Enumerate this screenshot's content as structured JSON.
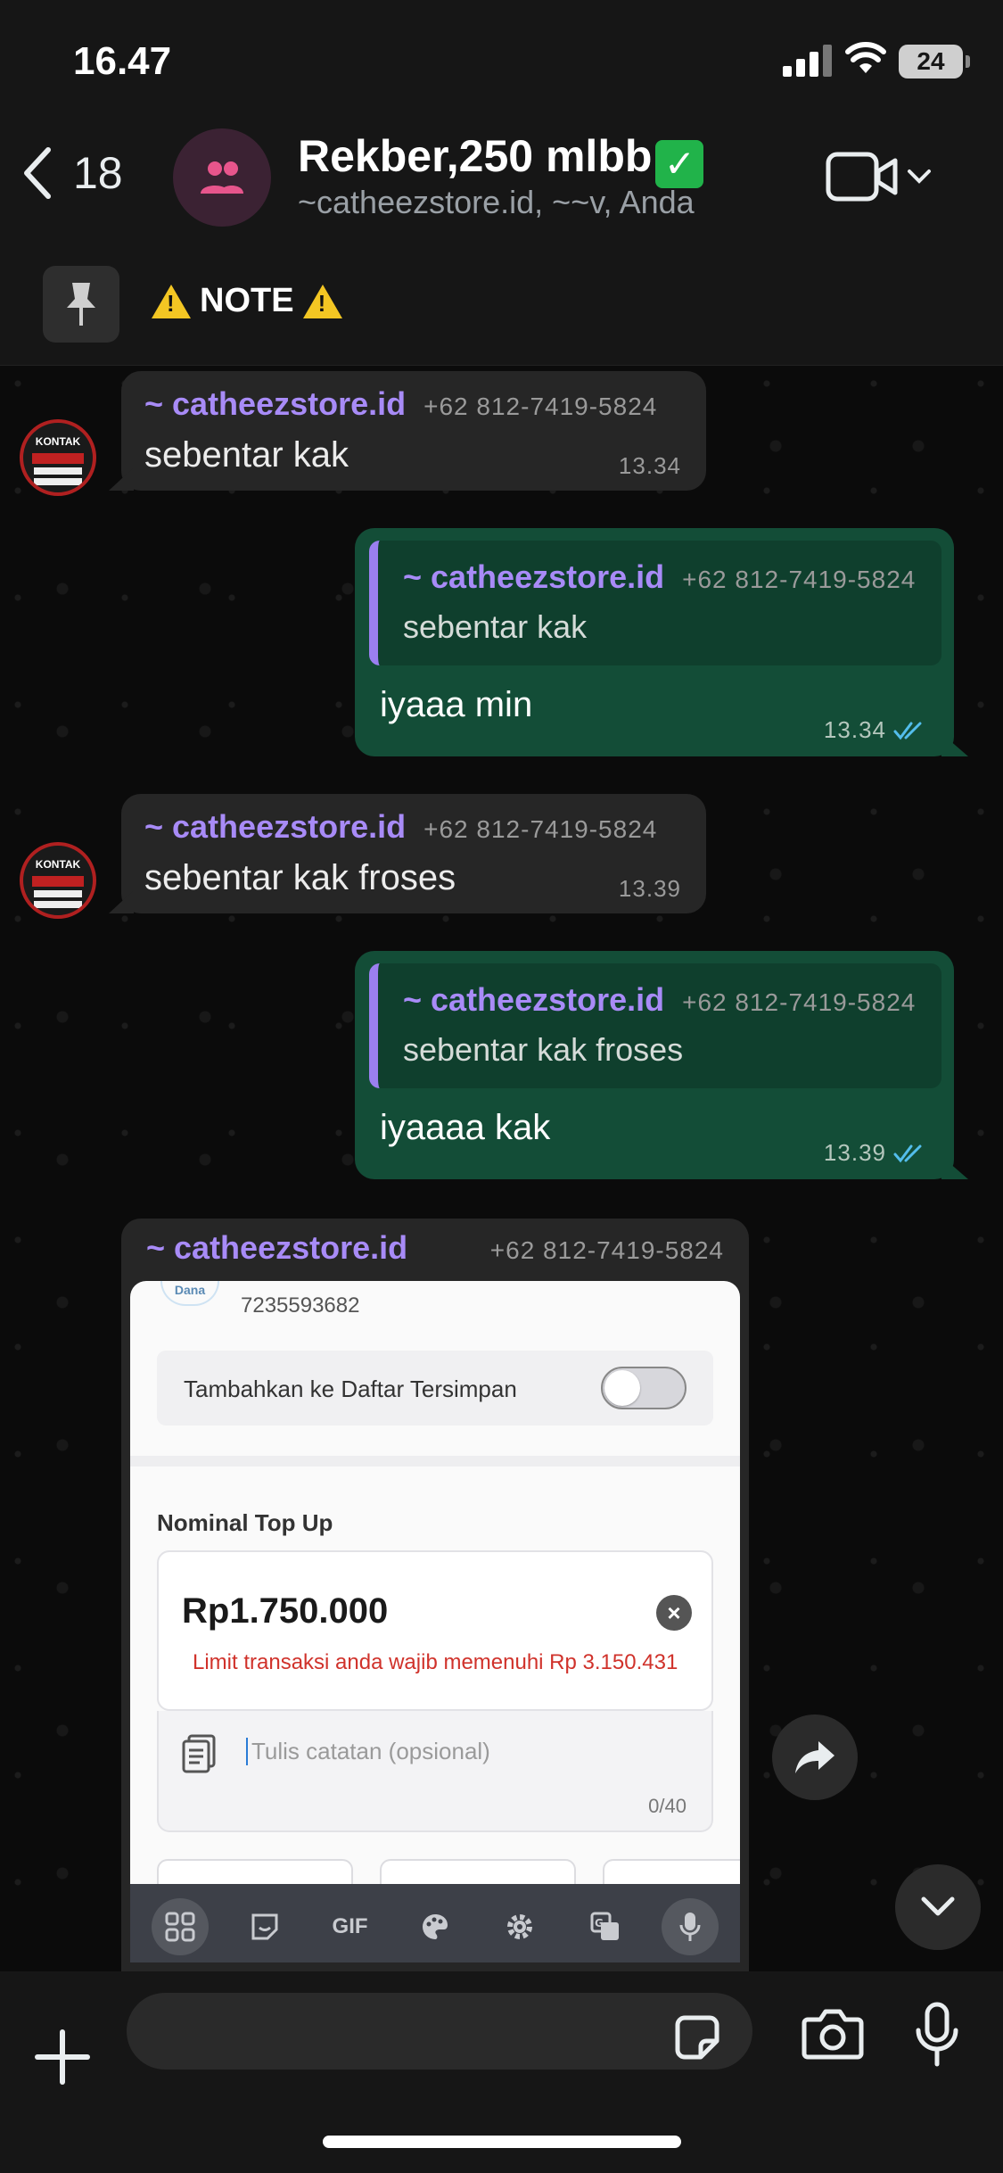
{
  "status": {
    "time": "16.47",
    "battery": "24"
  },
  "header": {
    "back_count": "18",
    "title": "Rekber,250 mlbb",
    "verified_emoji": "✅",
    "subtitle": "~catheezstore.id, ~~v, Anda"
  },
  "pinned": {
    "text": "NOTE"
  },
  "messages": [
    {
      "type": "incoming",
      "sender": "~ catheezstore.id",
      "phone": "+62 812-7419-5824",
      "text": "sebentar kak",
      "time": "13.34"
    },
    {
      "type": "outgoing",
      "quote_sender": "~ catheezstore.id",
      "quote_phone": "+62 812-7419-5824",
      "quote_text": "sebentar kak",
      "text": "iyaaa min",
      "time": "13.34"
    },
    {
      "type": "incoming",
      "sender": "~ catheezstore.id",
      "phone": "+62 812-7419-5824",
      "text": "sebentar kak froses",
      "time": "13.39"
    },
    {
      "type": "outgoing",
      "quote_sender": "~ catheezstore.id",
      "quote_phone": "+62 812-7419-5824",
      "quote_text": "sebentar kak froses",
      "text": "iyaaaa kak",
      "time": "13.39"
    }
  ],
  "image_message": {
    "sender": "~ catheezstore.id",
    "phone": "+62 812-7419-5824",
    "screenshot": {
      "wallet_logo": "Dana",
      "account_number": "7235593682",
      "save_label": "Tambahkan ke Daftar Tersimpan",
      "save_toggle_on": false,
      "nominal_label": "Nominal Top Up",
      "amount": "Rp1.750.000",
      "limit_warning": "Limit transaksi anda wajib memenuhi Rp 3.150.431",
      "note_placeholder": "Tulis catatan (opsional)",
      "note_count": "0/40",
      "keyboard_gif": "GIF"
    }
  },
  "composer": {
    "placeholder": ""
  },
  "colors": {
    "outgoing_bubble": "#134d37",
    "incoming_bubble": "#262626",
    "sender_name": "#a88bf7",
    "read_ticks": "#53bdeb",
    "limit_text": "#d0322b"
  },
  "icons": [
    "back-chevron-icon",
    "group-icon",
    "video-call-icon",
    "chevron-down-icon",
    "pin-icon",
    "warning-icon",
    "read-ticks-icon",
    "forward-icon",
    "plus-icon",
    "sticker-icon",
    "camera-icon",
    "microphone-icon"
  ]
}
